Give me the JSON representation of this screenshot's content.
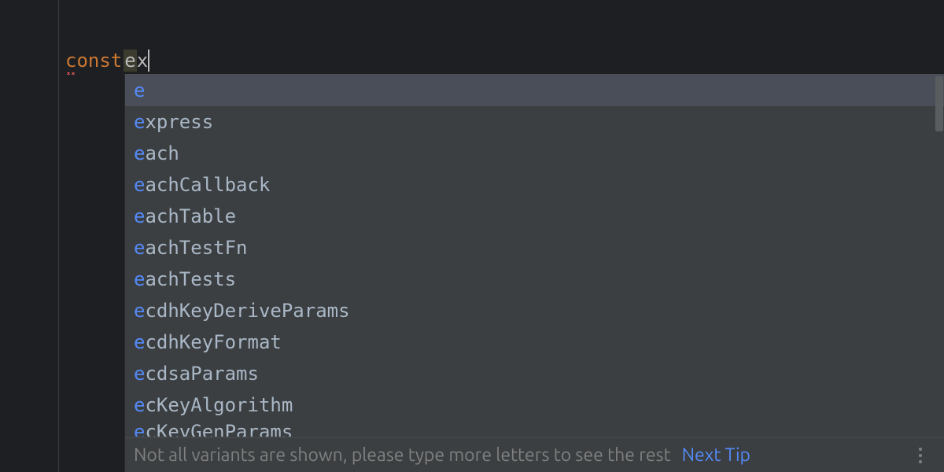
{
  "editor": {
    "keyword": "const",
    "typed_prefix": "e",
    "typed_suffix": "x"
  },
  "autocomplete": {
    "suggestions": [
      {
        "match": "e",
        "rest": "",
        "selected": true
      },
      {
        "match": "e",
        "rest": "xpress",
        "selected": false
      },
      {
        "match": "e",
        "rest": "ach",
        "selected": false
      },
      {
        "match": "e",
        "rest": "achCallback",
        "selected": false
      },
      {
        "match": "e",
        "rest": "achTable",
        "selected": false
      },
      {
        "match": "e",
        "rest": "achTestFn",
        "selected": false
      },
      {
        "match": "e",
        "rest": "achTests",
        "selected": false
      },
      {
        "match": "e",
        "rest": "cdhKeyDeriveParams",
        "selected": false
      },
      {
        "match": "e",
        "rest": "cdhKeyFormat",
        "selected": false
      },
      {
        "match": "e",
        "rest": "cdsaParams",
        "selected": false
      },
      {
        "match": "e",
        "rest": "cKeyAlgorithm",
        "selected": false
      }
    ],
    "partial_suggestion": {
      "match": "e",
      "rest": "cKeyGenParams"
    },
    "footer_text": "Not all variants are shown, please type more letters to see the rest",
    "next_tip_label": "Next Tip"
  }
}
